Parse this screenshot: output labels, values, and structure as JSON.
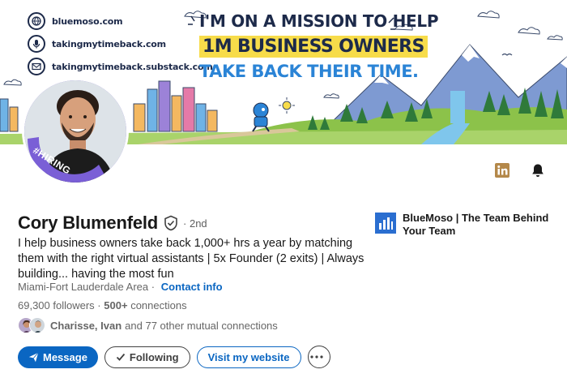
{
  "banner": {
    "links": [
      {
        "icon": "globe-icon",
        "text": "bluemoso.com"
      },
      {
        "icon": "microphone-icon",
        "text": "takingmytimeback.com"
      },
      {
        "icon": "newsletter-icon",
        "text": "takingmytimeback.substack.com"
      }
    ],
    "headline_line1": "I'M ON A MISSION TO HELP",
    "headline_line2": "1M BUSINESS OWNERS",
    "headline_line3": "TAKE BACK THEIR TIME."
  },
  "avatar": {
    "badge": "#HIRING",
    "ring_color": "#6e56cf"
  },
  "top_icons": [
    {
      "name": "linkedin-premium-icon",
      "color": "#b4884a"
    },
    {
      "name": "notification-bell-icon",
      "color": "#191919"
    }
  ],
  "profile": {
    "name": "Cory Blumenfeld",
    "degree": "· 2nd",
    "headline": "I help business owners take back 1,000+ hrs a year by matching them with the right virtual assistants | 5x Founder (2 exits) | Always building... having the most fun",
    "location": "Miami-Fort Lauderdale Area",
    "location_separator": "·",
    "contact_info": "Contact info",
    "followers": "69,300 followers",
    "connections_separator": "·",
    "connections": "500+",
    "connections_suffix": "connections",
    "mutual_names": "Charisse, Ivan",
    "mutual_suffix": "and 77 other mutual connections"
  },
  "company": {
    "name": "BlueMoso | The Team Behind Your Team",
    "logo_color": "#2a6ed0"
  },
  "actions": {
    "message": "Message",
    "following": "Following",
    "website": "Visit my website",
    "more": "···"
  },
  "colors": {
    "brand_blue": "#0a66c2",
    "text_primary": "#191919",
    "text_secondary": "#666666",
    "headline_navy": "#1d2a4a",
    "headline_yellow": "#f7dc4a",
    "headline_blue": "#2b84d6"
  }
}
